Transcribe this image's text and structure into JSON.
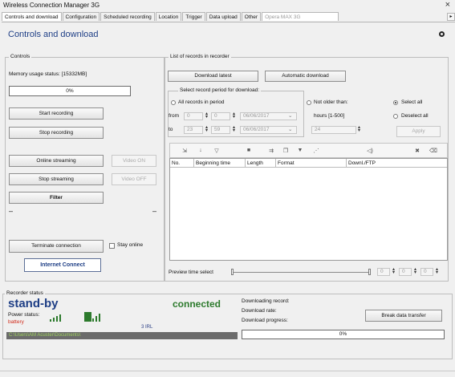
{
  "window": {
    "title": "Wireless Connection Manager 3G",
    "close": "×"
  },
  "tabs": [
    "Controls and download",
    "Configuration",
    "Scheduled recording",
    "Location",
    "Trigger",
    "Data upload",
    "Other"
  ],
  "tab_input": "Opera MAX 3G",
  "heading": "Controls and download",
  "controls": {
    "label": "Controls",
    "memory_label": "Memory usage status: [15332MB]",
    "memory_pct": "0%",
    "start_recording": "Start recording",
    "stop_recording": "Stop recording",
    "online_streaming": "Online streaming",
    "video_on": "Video ON",
    "stop_streaming": "Stop streaming",
    "video_off": "Video OFF",
    "filter": "Filter",
    "dash1": "–",
    "dash2": "–",
    "terminate": "Terminate connection",
    "stay_online": "Stay online",
    "internet_connect": "Internet Connect"
  },
  "records": {
    "label": "List of records in recorder",
    "download_latest": "Download latest",
    "auto_download": "Automatic download",
    "period_label": "Select record period for download:",
    "all_records": "All records in period",
    "not_older": "Not older than:",
    "select_all": "Select all",
    "deselect_all": "Deselect all",
    "from_label": "from",
    "to_label": "to",
    "from_h": "0",
    "from_m": "0",
    "from_date": "06/06/2017",
    "to_h": "23",
    "to_m": "59",
    "to_date": "06/06/2017",
    "hours_label": "hours [1-500]",
    "hours_value": "24",
    "apply": "Apply",
    "columns": [
      "No.",
      "Beginning time",
      "Length",
      "Format",
      "Downl./FTP"
    ],
    "preview_label": "Preview time select",
    "preview_a": "0",
    "preview_b": "0",
    "preview_c": "0"
  },
  "toolbar_icons": [
    "download-icon",
    "arrow-down-icon",
    "funnel-icon",
    "play-icon",
    "audio-icon",
    "copy-icon",
    "filter-icon",
    "map-icon",
    "speaker-icon",
    "delete-icon",
    "trash-icon"
  ],
  "status": {
    "label": "Recorder status",
    "state": "stand-by",
    "power_label": "Power status:",
    "battery": "battery",
    "signal_label": "3 IRL",
    "connected": "connected",
    "path": "C:\\Users\\AM Acuster\\Documents\\",
    "downloading_record": "Downloading record:",
    "download_rate": "Download rate:",
    "download_progress": "Download progress:",
    "break_transfer": "Break data transfer",
    "progress_pct": "0%",
    "progress_fraction": 0
  },
  "colors": {
    "heading": "#1f3f86",
    "standby": "#1f3f86",
    "connected": "#2c7a2c",
    "battery": "#d12a1a",
    "path_bg": "#6b6b6b",
    "path_fg": "#9fd35f"
  }
}
